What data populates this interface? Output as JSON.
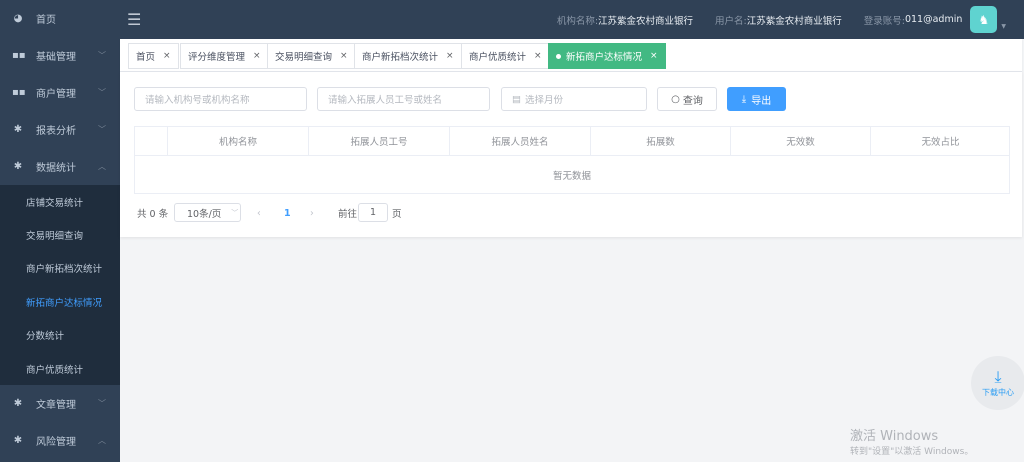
{
  "sidebar": {
    "items": [
      {
        "label": "首页",
        "icon": "dashboard-icon"
      },
      {
        "label": "基础管理",
        "icon": "grid-icon"
      },
      {
        "label": "商户管理",
        "icon": "grid-icon"
      },
      {
        "label": "报表分析",
        "icon": "gear-icon"
      },
      {
        "label": "数据统计",
        "icon": "gear-icon"
      }
    ],
    "submenu": [
      "店铺交易统计",
      "交易明细查询",
      "商户新拓档次统计",
      "新拓商户达标情况",
      "分数统计",
      "商户优质统计"
    ],
    "bottom": [
      {
        "label": "文章管理",
        "icon": "gear-icon"
      },
      {
        "label": "风险管理",
        "icon": "gear-icon"
      }
    ]
  },
  "header": {
    "org_label": "机构名称:",
    "org_value": "江苏紫金农村商业银行",
    "user_label": "用户名:",
    "user_value": "江苏紫金农村商业银行",
    "account_label": "登录账号:",
    "account_value": "011@admin"
  },
  "tabs": [
    "首页",
    "评分维度管理",
    "交易明细查询",
    "商户新拓档次统计",
    "商户优质统计",
    "新拓商户达标情况"
  ],
  "filters": {
    "org_placeholder": "请输入机构号或机构名称",
    "staff_placeholder": "请输入拓展人员工号或姓名",
    "month_placeholder": "选择月份",
    "query_label": "查询",
    "export_label": "导出"
  },
  "table": {
    "columns": [
      "机构名称",
      "拓展人员工号",
      "拓展人员姓名",
      "拓展数",
      "无效数",
      "无效占比"
    ],
    "empty_text": "暂无数据"
  },
  "pagination": {
    "total": "共 0 条",
    "page_size": "10条/页",
    "current": "1",
    "goto_label": "前往",
    "goto_value": "1",
    "page_suffix": "页"
  },
  "download_center": "下载中心",
  "watermark": {
    "title": "激活 Windows",
    "subtitle": "转到\"设置\"以激活 Windows。"
  },
  "colors": {
    "sidebar": "#304156",
    "active_tab": "#42b983",
    "primary": "#409eff"
  }
}
